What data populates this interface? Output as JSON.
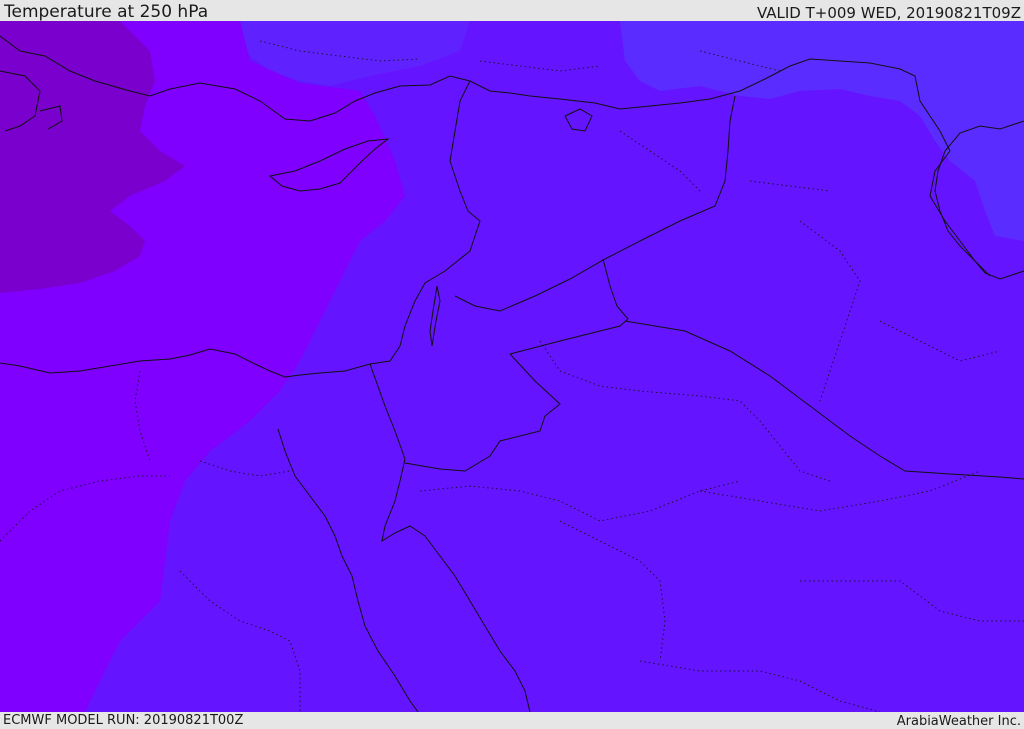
{
  "header": {
    "title": "Temperature at 250 hPa",
    "valid": "VALID T+009 WED, 20190821T09Z"
  },
  "footer": {
    "model_run": "ECMWF MODEL RUN: 20190821T00Z",
    "credit": "ArabiaWeather Inc."
  },
  "map": {
    "colors": {
      "cold_zone": "#7a00ce",
      "violet_zone": "#7f00ff",
      "indigo_zone": "#6514ff",
      "blue_zone": "#5b2cff",
      "lines": "#111111"
    }
  }
}
